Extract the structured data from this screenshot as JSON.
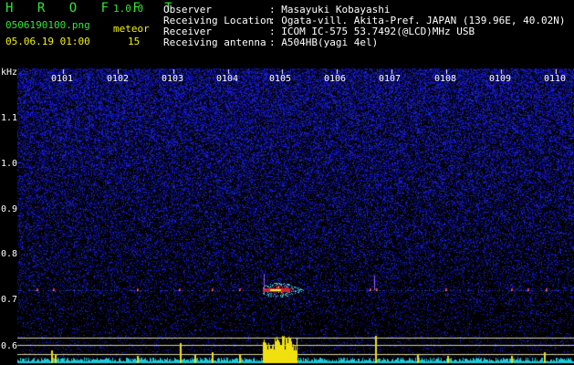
{
  "app": {
    "title": "H R O F F T",
    "version": "1.0.0",
    "filename": "0506190100.png",
    "datetime": "05.06.19 01:00",
    "meteor_label": "meteor",
    "meteor_count": "15"
  },
  "info": {
    "observer_label": "Observer",
    "observer_value": ": Masayuki Kobayashi",
    "location_label": "Receiving Location",
    "location_value": ": Ogata-vill. Akita-Pref. JAPAN (139.96E, 40.02N)",
    "receiver_label": "Receiver",
    "receiver_value": ": ICOM IC-575 53.7492(@LCD)MHz USB",
    "antenna_label": "Receiving antenna",
    "antenna_value": ": A504HB(yagi 4el)"
  },
  "axis": {
    "unit": "kHz",
    "ticks": [
      "1.1",
      "1.0",
      "0.9",
      "0.8",
      "0.7",
      "0.6"
    ],
    "minutes": [
      "0101",
      "0102",
      "0103",
      "0104",
      "0105",
      "0106",
      "0107",
      "0108",
      "0109",
      "0110"
    ]
  },
  "colors": {
    "background": "#000000",
    "header_green": "#34e534",
    "header_yellow": "#f4f20a",
    "noise_blue": "#2030c8",
    "baseline_cyan": "#1fc8d8",
    "activity_yellow": "#f0e010"
  }
}
